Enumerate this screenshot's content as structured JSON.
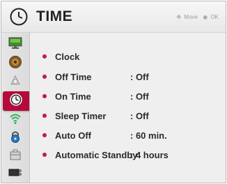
{
  "header": {
    "title": "TIME",
    "hint_move": "Move",
    "hint_ok": "OK"
  },
  "sidebar": {
    "items": [
      {
        "icon": "picture-icon",
        "active": false
      },
      {
        "icon": "audio-icon",
        "active": false
      },
      {
        "icon": "channel-icon",
        "active": false
      },
      {
        "icon": "clock-icon",
        "active": true
      },
      {
        "icon": "network-icon",
        "active": false
      },
      {
        "icon": "lock-icon",
        "active": false
      },
      {
        "icon": "option-icon",
        "active": false
      },
      {
        "icon": "input-icon",
        "active": false
      }
    ]
  },
  "menu": {
    "items": [
      {
        "label": "Clock",
        "value": ""
      },
      {
        "label": "Off Time",
        "value": ": Off"
      },
      {
        "label": "On Time",
        "value": ": Off"
      },
      {
        "label": "Sleep Timer",
        "value": ": Off"
      },
      {
        "label": "Auto Off",
        "value": ": 60 min."
      },
      {
        "label": "Automatic Standby",
        "value": ": 4 hours"
      }
    ]
  },
  "colors": {
    "accent": "#b50a3c",
    "bullet": "#c21a4a"
  }
}
